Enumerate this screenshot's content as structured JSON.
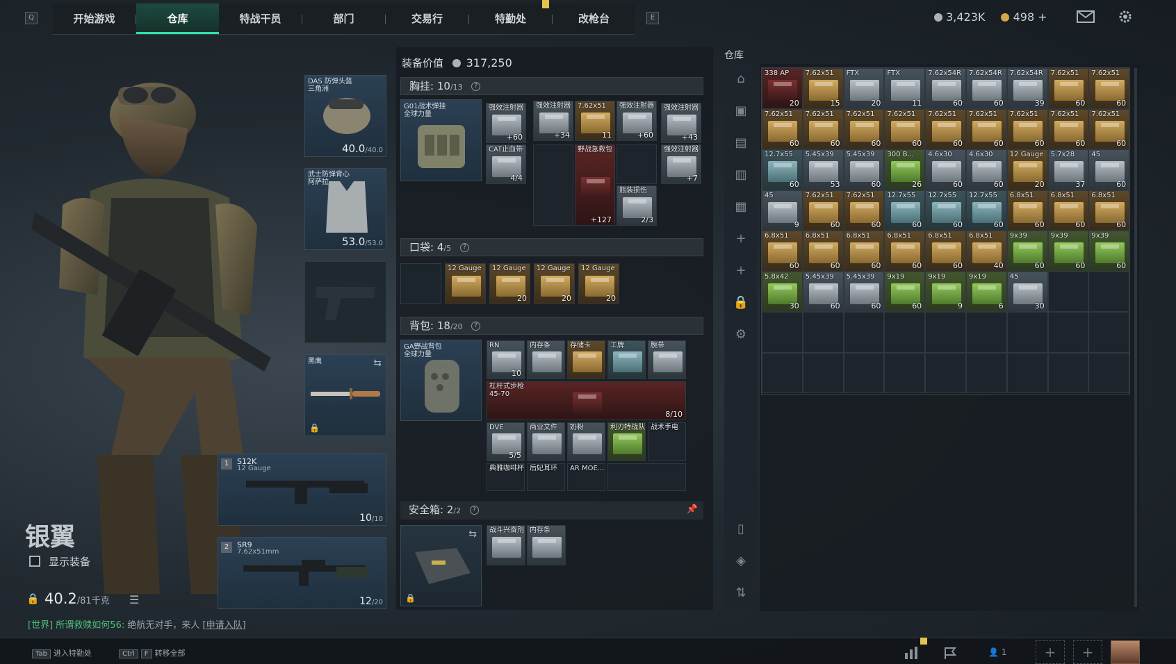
{
  "nav": {
    "left_key": "Q",
    "right_key": "E",
    "tabs": [
      "开始游戏",
      "仓库",
      "特战干员",
      "部门",
      "交易行",
      "特勤处",
      "改枪台"
    ],
    "active_tab": "仓库"
  },
  "currency": {
    "silver": "3,423K",
    "gold": "498",
    "gold_add": "+"
  },
  "character": {
    "name": "银翼",
    "show_gear_label": "显示装备",
    "weight": "40.2",
    "weight_max": "/81千克"
  },
  "chat": {
    "channel": "[世界]",
    "sender": "所谓救赎如何56:",
    "message": "绝航无对手，来人",
    "link": "[申请入队]"
  },
  "gear_slots": {
    "helmet": {
      "name": "DAS 防弹头盔",
      "sub": "三角洲",
      "durability": "40.0",
      "max": "/40.0"
    },
    "armor": {
      "name": "武士防弹背心",
      "sub": "阿萨拉",
      "durability": "53.0",
      "max": "/53.0"
    },
    "melee": {
      "name": "黑鹰"
    },
    "primary": {
      "slot": "1",
      "name": "S12K",
      "ammo": "12 Gauge",
      "mag": "10",
      "mag_max": "/10"
    },
    "secondary": {
      "slot": "2",
      "name": "SR9",
      "ammo": "7.62x51mm",
      "mag": "12",
      "mag_max": "/20"
    }
  },
  "loadout": {
    "value_label": "装备价值",
    "value": "317,250",
    "chest": {
      "label": "胸挂:",
      "used": "10",
      "max": "/13",
      "rig_name": "G01战术弹挂",
      "rig_sub": "全球力量"
    },
    "chest_items": [
      {
        "label": "强效注射器",
        "count": "+60"
      },
      {
        "label": "CAT止血带",
        "count": "4/4"
      },
      {
        "label": "强效注射器",
        "count": "+34"
      },
      {
        "label": "7.62x51",
        "count": "11"
      },
      {
        "label": "强效注射器",
        "count": "+60"
      },
      {
        "label": "野战急救包",
        "count": "+127"
      },
      {
        "label": "瓶装损伤",
        "count": "2/3"
      },
      {
        "label": "强效注射器",
        "count": "+43"
      },
      {
        "label": "强效注射器",
        "count": "+7"
      }
    ],
    "pockets": {
      "label": "口袋:",
      "used": "4",
      "max": "/5"
    },
    "pocket_items": [
      {
        "label": "12 Gauge",
        "count": ""
      },
      {
        "label": "12 Gauge",
        "count": "20"
      },
      {
        "label": "12 Gauge",
        "count": "20"
      },
      {
        "label": "12 Gauge",
        "count": "20"
      }
    ],
    "backpack": {
      "label": "背包:",
      "used": "18",
      "max": "/20",
      "bag_name": "GA野战背包",
      "bag_sub": "全球力量"
    },
    "backpack_items": [
      {
        "label": "RN",
        "count": "10"
      },
      {
        "label": "内存条",
        "count": ""
      },
      {
        "label": "存储卡",
        "count": ""
      },
      {
        "label": "工牌",
        "count": ""
      },
      {
        "label": "腕带",
        "count": ""
      },
      {
        "label": "杠杆式步枪",
        "sub": "45-70",
        "count": "8/10"
      },
      {
        "label": "DVE",
        "count": "5/5"
      },
      {
        "label": "商业文件",
        "count": ""
      },
      {
        "label": "奶粉",
        "count": ""
      },
      {
        "label": "利刃特战队",
        "count": ""
      },
      {
        "label": "战术手电",
        "count": ""
      },
      {
        "label": "典雅咖啡杯",
        "count": ""
      },
      {
        "label": "后妃耳环",
        "count": ""
      },
      {
        "label": "AR MOE...",
        "count": ""
      }
    ],
    "safebox": {
      "label": "安全箱:",
      "used": "2",
      "max": "/2"
    },
    "safebox_items": [
      {
        "label": "战斗兴奋剂",
        "count": ""
      },
      {
        "label": "内存条",
        "count": ""
      }
    ]
  },
  "stash": {
    "title": "仓库",
    "items": [
      {
        "label": "338 AP",
        "count": "20",
        "tone": "red"
      },
      {
        "label": "7.62x51",
        "count": "15",
        "tone": "gold"
      },
      {
        "label": "FTX",
        "count": "20",
        "tone": "silver"
      },
      {
        "label": "FTX",
        "count": "11",
        "tone": "silver"
      },
      {
        "label": "7.62x54R",
        "count": "60",
        "tone": "silver"
      },
      {
        "label": "7.62x54R",
        "count": "60",
        "tone": "silver"
      },
      {
        "label": "7.62x54R",
        "count": "39",
        "tone": "silver"
      },
      {
        "label": "7.62x51",
        "count": "60",
        "tone": "gold"
      },
      {
        "label": "7.62x51",
        "count": "60",
        "tone": "gold"
      },
      {
        "label": "7.62x51",
        "count": "60",
        "tone": "gold"
      },
      {
        "label": "7.62x51",
        "count": "60",
        "tone": "gold"
      },
      {
        "label": "7.62x51",
        "count": "60",
        "tone": "gold"
      },
      {
        "label": "7.62x51",
        "count": "60",
        "tone": "gold"
      },
      {
        "label": "7.62x51",
        "count": "60",
        "tone": "gold"
      },
      {
        "label": "7.62x51",
        "count": "60",
        "tone": "gold"
      },
      {
        "label": "7.62x51",
        "count": "60",
        "tone": "gold"
      },
      {
        "label": "7.62x51",
        "count": "60",
        "tone": "gold"
      },
      {
        "label": "7.62x51",
        "count": "60",
        "tone": "gold"
      },
      {
        "label": "12.7x55",
        "count": "60",
        "tone": "teal"
      },
      {
        "label": "5.45x39",
        "count": "53",
        "tone": "silver"
      },
      {
        "label": "5.45x39",
        "count": "60",
        "tone": "silver"
      },
      {
        "label": "300 B...",
        "count": "26",
        "tone": "green"
      },
      {
        "label": "4.6x30",
        "count": "60",
        "tone": "silver"
      },
      {
        "label": "4.6x30",
        "count": "60",
        "tone": "silver"
      },
      {
        "label": "12 Gauge",
        "count": "20",
        "tone": "gold"
      },
      {
        "label": "5.7x28",
        "count": "37",
        "tone": "silver"
      },
      {
        "label": "45",
        "count": "60",
        "tone": "silver"
      },
      {
        "label": "45",
        "count": "9",
        "tone": "silver"
      },
      {
        "label": "7.62x51",
        "count": "60",
        "tone": "gold"
      },
      {
        "label": "7.62x51",
        "count": "60",
        "tone": "gold"
      },
      {
        "label": "12.7x55",
        "count": "60",
        "tone": "teal"
      },
      {
        "label": "12.7x55",
        "count": "60",
        "tone": "teal"
      },
      {
        "label": "12.7x55",
        "count": "60",
        "tone": "teal"
      },
      {
        "label": "6.8x51",
        "count": "60",
        "tone": "gold"
      },
      {
        "label": "6.8x51",
        "count": "60",
        "tone": "gold"
      },
      {
        "label": "6.8x51",
        "count": "60",
        "tone": "gold"
      },
      {
        "label": "6.8x51",
        "count": "60",
        "tone": "gold"
      },
      {
        "label": "6.8x51",
        "count": "60",
        "tone": "gold"
      },
      {
        "label": "6.8x51",
        "count": "60",
        "tone": "gold"
      },
      {
        "label": "6.8x51",
        "count": "60",
        "tone": "gold"
      },
      {
        "label": "6.8x51",
        "count": "60",
        "tone": "gold"
      },
      {
        "label": "6.8x51",
        "count": "40",
        "tone": "gold"
      },
      {
        "label": "9x39",
        "count": "60",
        "tone": "green"
      },
      {
        "label": "9x39",
        "count": "60",
        "tone": "green"
      },
      {
        "label": "9x39",
        "count": "60",
        "tone": "green"
      },
      {
        "label": "5.8x42",
        "count": "30",
        "tone": "green"
      },
      {
        "label": "5.45x39",
        "count": "60",
        "tone": "silver"
      },
      {
        "label": "5.45x39",
        "count": "60",
        "tone": "silver"
      },
      {
        "label": "9x19",
        "count": "60",
        "tone": "green"
      },
      {
        "label": "9x19",
        "count": "9",
        "tone": "green"
      },
      {
        "label": "9x19",
        "count": "6",
        "tone": "green"
      },
      {
        "label": "45",
        "count": "30",
        "tone": "silver"
      }
    ],
    "side_icons": [
      "armory-icon",
      "camera-icon",
      "folder-icon",
      "folder-alt-icon",
      "image-icon",
      "plus-icon",
      "plus-icon",
      "lock-icon",
      "gear-icon",
      "phone-icon",
      "layers-icon",
      "sort-icon"
    ]
  },
  "bottom": {
    "hint1_key": "Tab",
    "hint1_text": "进入特勤处",
    "hint2_key1": "Ctrl",
    "hint2_key2": "F",
    "hint2_text": "转移全部",
    "squad_count": "1"
  },
  "colors": {
    "accent": "#2fe0a8",
    "gold_box": "#c9a25a",
    "green_box": "#8cc454",
    "chat_green": "#4fbf7a"
  }
}
